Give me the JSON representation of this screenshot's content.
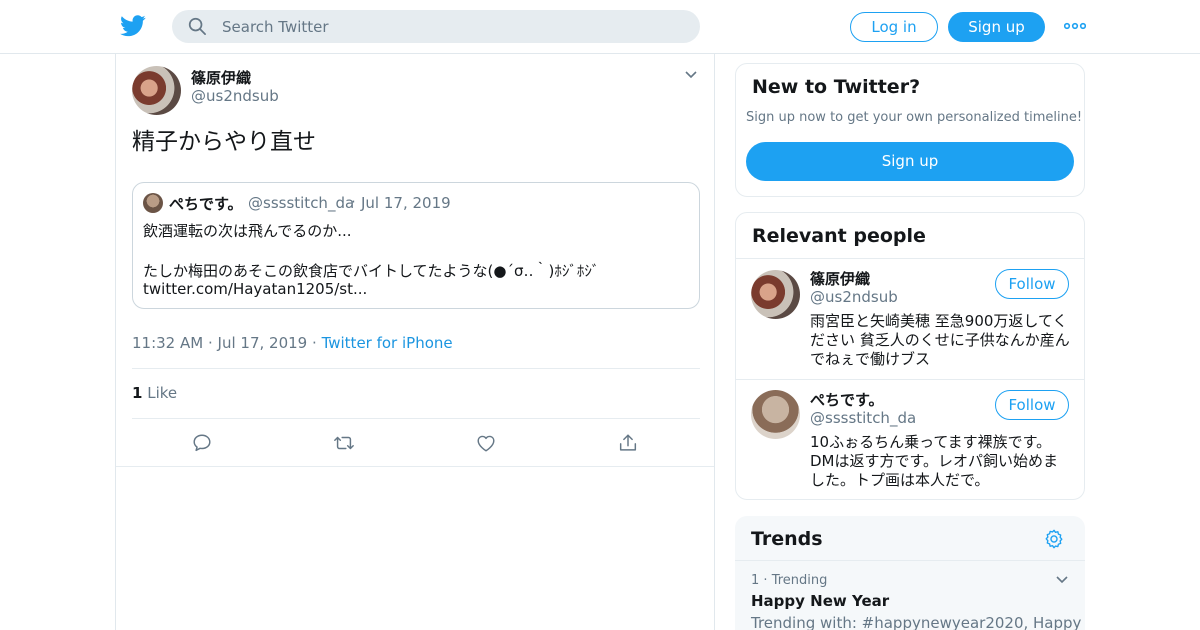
{
  "colors": {
    "brand": "#1da1f2",
    "link": "#1b95e0",
    "muted": "#657786"
  },
  "header": {
    "logo_icon": "twitter-bird-icon",
    "search_placeholder": "Search Twitter",
    "login_label": "Log in",
    "signup_label": "Sign up",
    "more_icon": "more-dots-icon"
  },
  "tweet": {
    "author_name": "篠原伊織",
    "author_handle": "@us2ndsub",
    "text": "精子からやり直せ",
    "quote": {
      "name": "ぺちです。",
      "handle": "@sssstitch_da",
      "separator": "·",
      "date": "Jul 17, 2019",
      "line1": "飲酒運転の次は飛んでるのか...",
      "line2": "たしか梅田のあそこの飲食店でバイトしてたような(●´σ‥｀)ﾎｼﾞﾎｼﾞ",
      "line3": "twitter.com/Hayatan1205/st..."
    },
    "time": "11:32 AM",
    "separator": "·",
    "date": "Jul 17, 2019",
    "source": "Twitter for iPhone",
    "like_count": "1",
    "like_label": "Like",
    "actions": [
      "reply-icon",
      "retweet-icon",
      "like-icon",
      "share-icon"
    ]
  },
  "sidebar": {
    "new_to_twitter": {
      "title": "New to Twitter?",
      "subtitle": "Sign up now to get your own personalized timeline!",
      "button": "Sign up"
    },
    "relevant_people": {
      "title": "Relevant people",
      "people": [
        {
          "name": "篠原伊織",
          "handle": "@us2ndsub",
          "follow": "Follow",
          "bio": "雨宮臣と矢崎美穂 至急900万返してください 貧乏人のくせに子供なんか産んでねぇで働けブス"
        },
        {
          "name": "ぺちです。",
          "handle": "@sssstitch_da",
          "follow": "Follow",
          "bio": "10ふぉるちん乗ってます裸族です。DMは返す方です。レオパ飼い始めました。トプ画は本人だで。"
        }
      ]
    },
    "trends": {
      "title": "Trends",
      "items": [
        {
          "rank": "1",
          "separator": "·",
          "label": "Trending",
          "name": "Happy New Year",
          "with": "Trending with: #happynewyear2020, Happy"
        }
      ]
    }
  }
}
